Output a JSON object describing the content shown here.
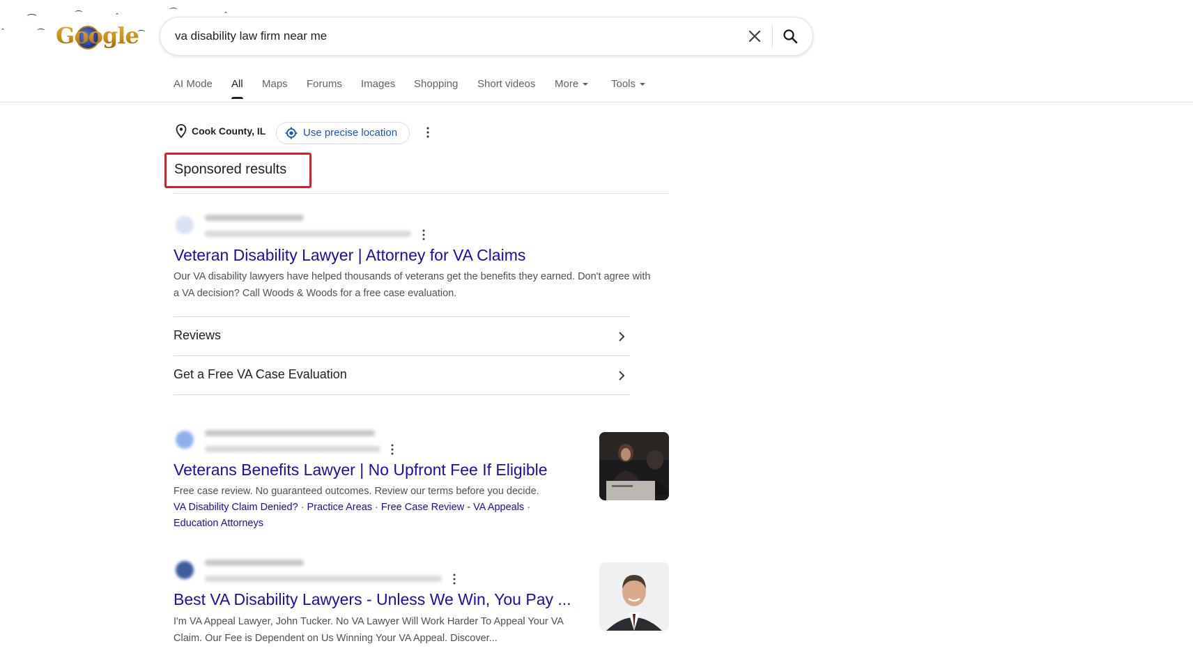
{
  "search": {
    "query": "va disability law firm near me"
  },
  "logo": {
    "text": "Google"
  },
  "tabs": [
    {
      "label": "AI Mode",
      "active": false
    },
    {
      "label": "All",
      "active": true
    },
    {
      "label": "Maps",
      "active": false
    },
    {
      "label": "Forums",
      "active": false
    },
    {
      "label": "Images",
      "active": false
    },
    {
      "label": "Shopping",
      "active": false
    },
    {
      "label": "Short videos",
      "active": false
    },
    {
      "label": "More",
      "active": false
    },
    {
      "label": "Tools",
      "active": false
    }
  ],
  "location": {
    "name": "Cook County, IL",
    "precise_label": "Use precise location"
  },
  "sponsored": {
    "heading": "Sponsored results"
  },
  "ads": [
    {
      "title": "Veteran Disability Lawyer | Attorney for VA Claims",
      "description": "Our VA disability lawyers have helped thousands of veterans get the benefits they earned. Don't agree with a VA decision? Call Woods & Woods for a free case evaluation.",
      "sitelinks": [
        "Reviews",
        "Get a Free VA Case Evaluation"
      ]
    },
    {
      "title": "Veterans Benefits Lawyer | No Upfront Fee If Eligible",
      "description": "Free case review. No guaranteed outcomes. Review our terms before you decide.",
      "inline_links": [
        "VA Disability Claim Denied?",
        "Practice Areas",
        "Free Case Review - VA Appeals",
        "Education Attorneys"
      ]
    },
    {
      "title": "Best VA Disability Lawyers - Unless We Win, You Pay ...",
      "description": "I'm VA Appeal Lawyer, John Tucker. No VA Lawyer Will Work Harder To Appeal Your VA Claim. Our Fee is Dependent on Us Winning Your VA Appeal. Discover..."
    }
  ],
  "colors": {
    "link": "#1a0dab",
    "highlight_box": "#d4202a",
    "divider": "#dadce0"
  }
}
